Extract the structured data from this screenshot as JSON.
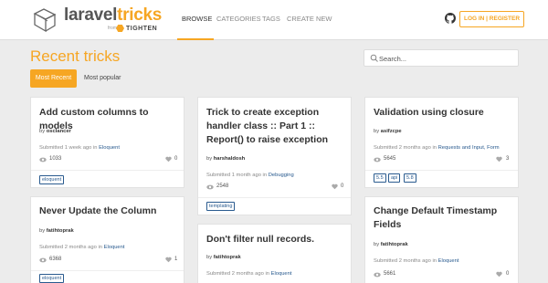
{
  "brand": {
    "name_part1": "laravel",
    "name_part2": "tricks",
    "from_label": "from",
    "company": "TIGHTEN"
  },
  "nav": {
    "items": [
      "BROWSE",
      "CATEGORIES",
      "TAGS",
      "CREATE NEW"
    ],
    "active": "BROWSE"
  },
  "header_actions": {
    "github_icon": "github-icon",
    "login_label": "LOG IN | REGISTER"
  },
  "page": {
    "title": "Recent tricks"
  },
  "search": {
    "placeholder": "Search...",
    "value": ""
  },
  "filters": {
    "items": [
      "Most Recent",
      "Most popular"
    ],
    "active": "Most Recent"
  },
  "cards": [
    {
      "title": "Add custom columns to models",
      "by_label": "by",
      "author": "oscIancer",
      "submitted": "Submitted 1 week ago in",
      "categories": "Eloquent",
      "views": "1033",
      "likes": "0",
      "tags": [
        "eloquent"
      ]
    },
    {
      "title": "Trick to create exception handler class :: Part 1 :: Report() to raise exception",
      "by_label": "by",
      "author": "harshaldosh",
      "submitted": "Submitted 1 month ago in",
      "categories": "Debugging",
      "views": "2548",
      "likes": "0",
      "tags": [
        "templating"
      ]
    },
    {
      "title": "Validation using closure",
      "by_label": "by",
      "author": "asifzcpe",
      "submitted": "Submitted 2 months ago in",
      "categories": "Requests and Input, Form",
      "views": "5645",
      "likes": "3",
      "tags": [
        "5.5",
        "api",
        "5.8"
      ]
    },
    {
      "title": "Never Update the Column",
      "by_label": "by",
      "author": "fatihtoprak",
      "submitted": "Submitted 2 months ago in",
      "categories": "Eloquent",
      "views": "6368",
      "likes": "1",
      "tags": [
        "eloquent"
      ]
    },
    {
      "title": "Don't filter null records.",
      "by_label": "by",
      "author": "fatihtoprak",
      "submitted": "Submitted 2 months ago in",
      "categories": "Eloquent",
      "views": "",
      "likes": "",
      "tags": []
    },
    {
      "title": "Change Default Timestamp Fields",
      "by_label": "by",
      "author": "fatihtoprak",
      "submitted": "Submitted 2 months ago in",
      "categories": "Eloquent",
      "views": "5661",
      "likes": "0",
      "tags": []
    }
  ],
  "colors": {
    "accent": "#f6a623",
    "link": "#2a5b8f",
    "background": "#ececec"
  }
}
